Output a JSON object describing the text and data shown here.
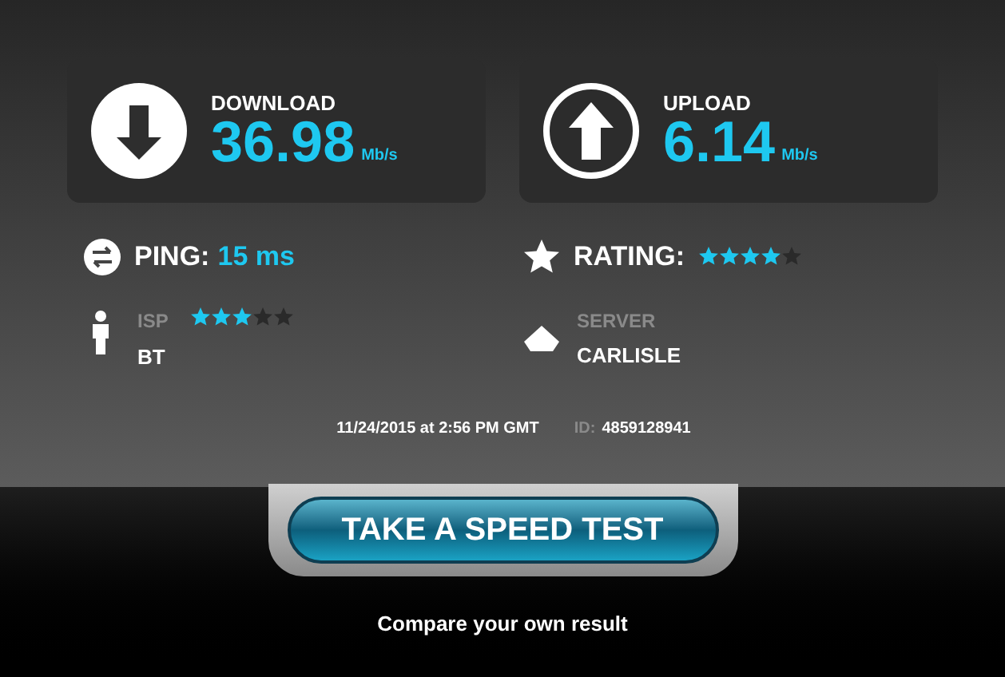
{
  "metrics": [
    {
      "kind": "download",
      "label": "DOWNLOAD",
      "value": "36.98",
      "unit": "Mb/s"
    },
    {
      "kind": "upload",
      "label": "UPLOAD",
      "value": "6.14",
      "unit": "Mb/s"
    }
  ],
  "ping": {
    "label": "PING:",
    "value": "15 ms"
  },
  "rating": {
    "label": "RATING:",
    "stars": 4
  },
  "isp": {
    "label": "ISP",
    "value": "BT",
    "stars": 3
  },
  "server": {
    "label": "SERVER",
    "value": "CARLISLE"
  },
  "timestamp": "11/24/2015 at 2:56 PM GMT",
  "result_id": {
    "label": "ID:",
    "value": "4859128941"
  },
  "button": "TAKE A SPEED TEST",
  "link": "Compare your own result"
}
